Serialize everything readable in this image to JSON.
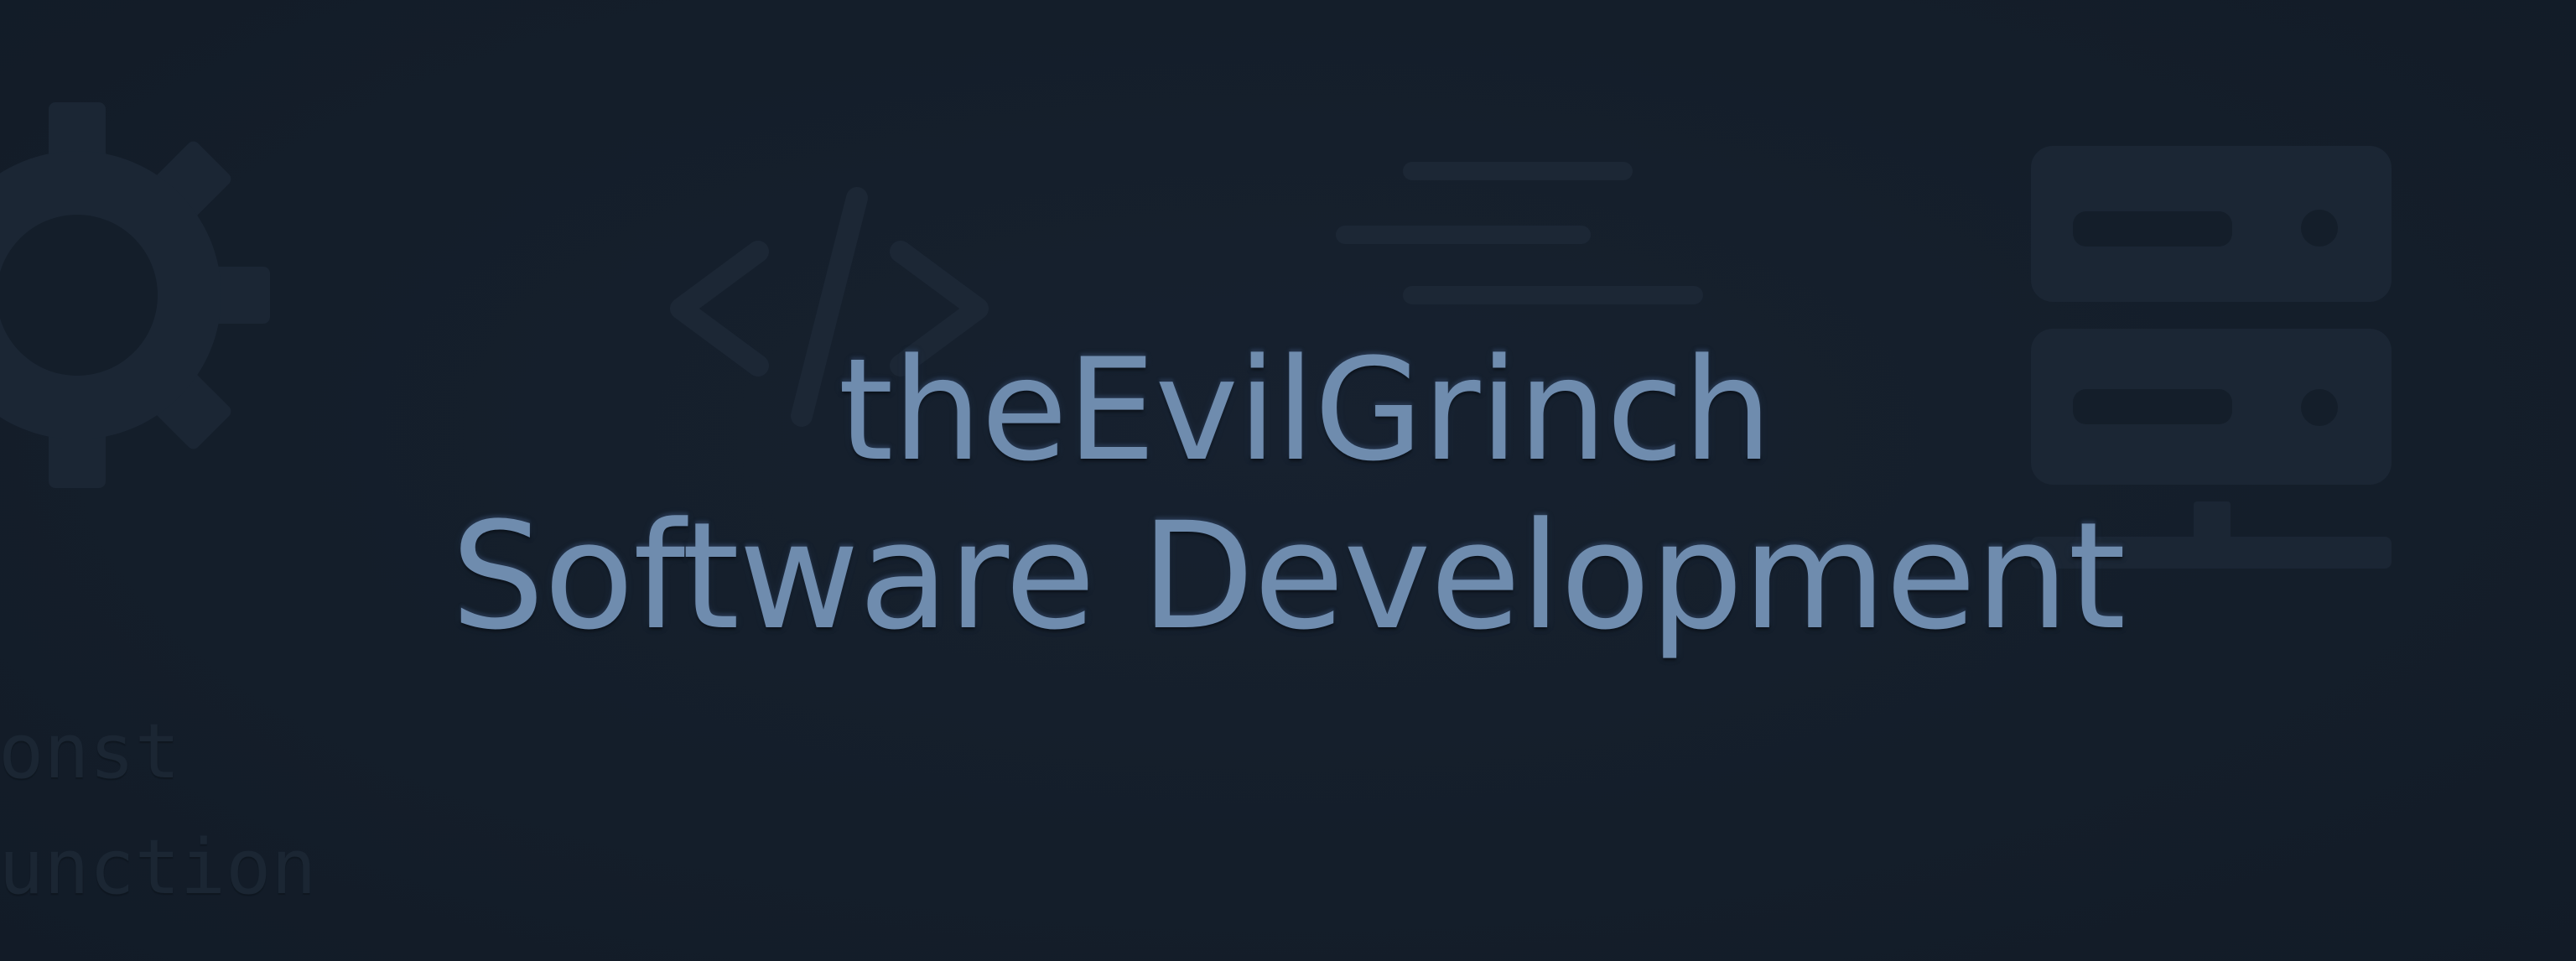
{
  "banner": {
    "title_line_1": "theEvilGrinch",
    "title_line_2": "Software Development"
  },
  "background": {
    "code_lines": [
      "const",
      "function"
    ],
    "icons": [
      "gear-icon",
      "code-brackets-icon",
      "text-lines-icon",
      "server-icon"
    ]
  },
  "colors": {
    "background": "#141e2b",
    "title": "#6f8cae",
    "icon_fill": "#1b2634"
  }
}
